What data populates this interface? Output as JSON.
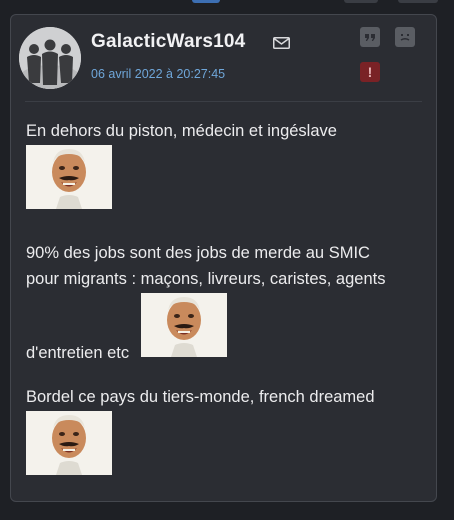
{
  "post": {
    "username": "GalacticWars104",
    "date": "06 avril 2022 à 20:27:45",
    "lines": [
      "En dehors du piston, médecin et ingéslave",
      "90% des jobs sont des jobs de merde au SMIC",
      "pour migrants : maçons, livreurs, caristes, agents",
      "d'entretien etc",
      "Bordel ce pays du tiers-monde, french dreamed"
    ],
    "report_label": "!"
  },
  "icons": {
    "mail": "envelope-icon",
    "quote": "quote-icon",
    "smiley": "smiley-icon",
    "report": "alert-icon"
  },
  "colors": {
    "username": "#f1f1f3",
    "date": "#6fa6d9",
    "report": "#7a2226",
    "card": "#2b2d33"
  }
}
